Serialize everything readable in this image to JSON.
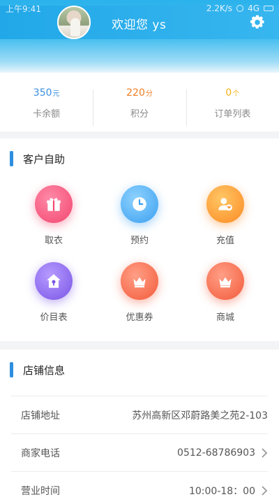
{
  "status_bar": {
    "time": "上午9:41",
    "speed": "2.2K/s",
    "network": "4G"
  },
  "header": {
    "welcome": "欢迎您 ys"
  },
  "stats": [
    {
      "value": "350",
      "unit": "元",
      "label": "卡余额",
      "color": "#3a8fdf"
    },
    {
      "value": "220",
      "unit": "分",
      "label": "积分",
      "color": "#f07d23"
    },
    {
      "value": "0",
      "unit": "个",
      "label": "订单列表",
      "color": "#f3b21b"
    }
  ],
  "self_service": {
    "title": "客户自助",
    "items": [
      {
        "label": "取衣",
        "icon": "gift-icon"
      },
      {
        "label": "预约",
        "icon": "clock-icon"
      },
      {
        "label": "充值",
        "icon": "user-recharge-icon"
      },
      {
        "label": "价目表",
        "icon": "house-icon"
      },
      {
        "label": "优惠券",
        "icon": "crown-icon"
      },
      {
        "label": "商城",
        "icon": "crown-icon"
      }
    ]
  },
  "shop_info": {
    "title": "店铺信息",
    "rows": [
      {
        "label": "店铺地址",
        "value": "苏州高新区邓蔚路美之苑2-103"
      },
      {
        "label": "商家电话",
        "value": "0512-68786903"
      },
      {
        "label": "营业时间",
        "value": "10:00-18：00"
      }
    ]
  },
  "colors": {
    "accent": "#2e8fe0",
    "header": "#2bb2ec"
  }
}
